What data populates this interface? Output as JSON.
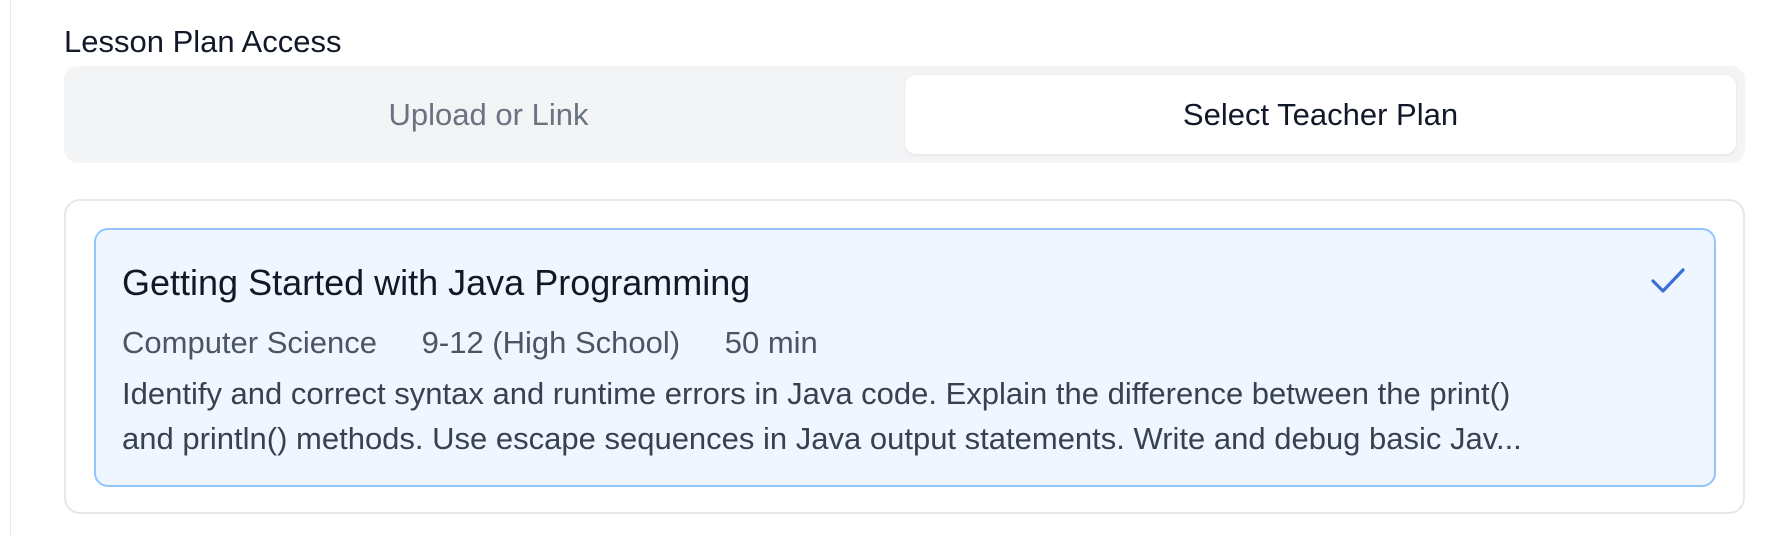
{
  "section": {
    "label": "Lesson Plan Access"
  },
  "tabs": [
    {
      "label": "Upload or Link",
      "active": false
    },
    {
      "label": "Select Teacher Plan",
      "active": true
    }
  ],
  "plan": {
    "title": "Getting Started with Java Programming",
    "subject": "Computer Science",
    "grade": "9-12 (High School)",
    "duration": "50 min",
    "description_lines": [
      "Identify and correct syntax and runtime errors in Java code. Explain the difference between the print()",
      "and println() methods. Use escape sequences in Java output statements. Write and debug basic Jav..."
    ],
    "selected": true,
    "selected_icon": "check-icon"
  },
  "colors": {
    "accent": "#3b6fd8",
    "card_bg": "#eff6ff",
    "card_border": "#93c5fd",
    "tab_track": "#f3f4f6"
  }
}
